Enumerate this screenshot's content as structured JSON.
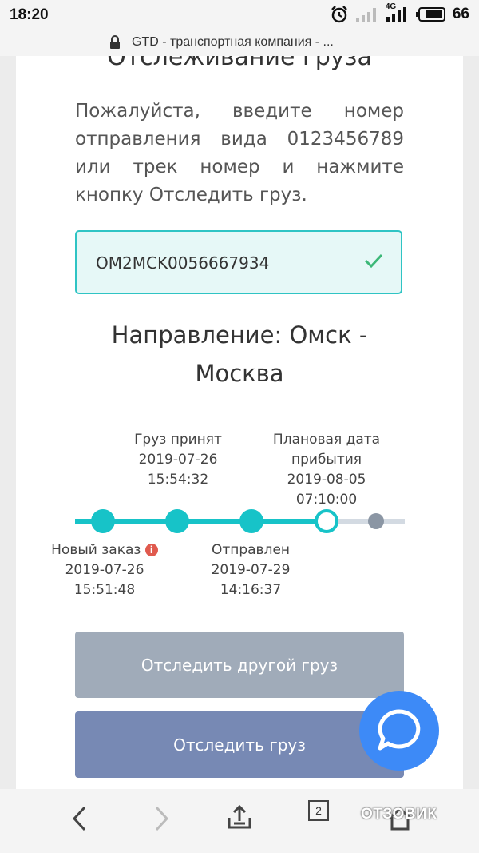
{
  "status_bar": {
    "time": "18:20",
    "network": "4G",
    "battery": "66"
  },
  "browser": {
    "url_title": "GTD - транспортная компания - ..."
  },
  "page": {
    "title": "Отслеживание груза",
    "instructions": "Пожалуйста, введите номер отправления вида 0123456789 или трек номер и нажмите кнопку Отследить груз.",
    "tracking_input": {
      "value": "OM2MCK0056667934",
      "placeholder": ""
    },
    "direction": "Направление: Омск - Москва",
    "timeline": {
      "steps": [
        {
          "label": "Новый заказ",
          "date": "2019-07-26",
          "time": "15:51:48",
          "status": "done"
        },
        {
          "label": "Груз принят",
          "date": "2019-07-26",
          "time": "15:54:32",
          "status": "done"
        },
        {
          "label": "Отправлен",
          "date": "2019-07-29",
          "time": "14:16:37",
          "status": "done"
        },
        {
          "label": "Плановая дата прибытия",
          "label_line1": "Плановая дата",
          "label_line2": "прибытия",
          "date": "2019-08-05",
          "time": "07:10:00",
          "status": "current"
        },
        {
          "label": "",
          "status": "pending"
        }
      ]
    },
    "buttons": {
      "track_other": "Отследить другой груз",
      "track": "Отследить груз"
    }
  },
  "bottom_nav": {
    "tabs_count": "2"
  },
  "watermark": "ОТЗОВИК",
  "colors": {
    "accent": "#17c3c8",
    "btn_other": "#a0abb9",
    "btn_track": "#7789b4",
    "chat": "#3d8af7",
    "error": "#e05a4e"
  }
}
